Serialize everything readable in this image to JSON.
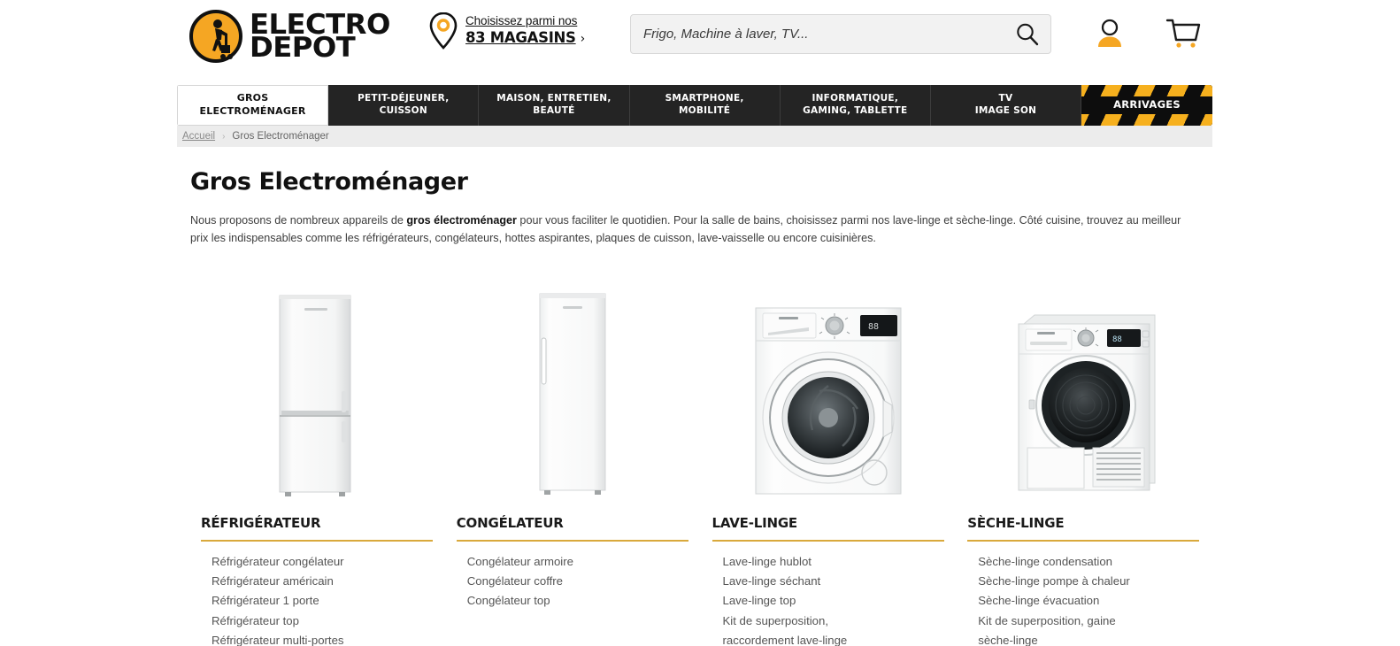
{
  "header": {
    "logo": {
      "line1": "ELECTRO",
      "line2": "DEPOT",
      "icon": "worker-with-trolley-icon"
    },
    "stores": {
      "top_label": "Choisissez parmi nos",
      "count_label": "83 MAGASINS",
      "chevron": "›",
      "pin_icon": "map-pin-icon"
    },
    "search": {
      "placeholder": "Frigo, Machine à laver, TV...",
      "value": "",
      "icon": "search-icon"
    },
    "account_icon": "user-account-icon",
    "cart_icon": "shopping-cart-icon"
  },
  "nav": {
    "items": [
      {
        "label": "GROS\nELECTROMÉNAGER",
        "line1": "GROS",
        "line2": "ELECTROMÉNAGER",
        "active": true
      },
      {
        "line1": "PETIT-DÉJEUNER,",
        "line2": "CUISSON",
        "active": false
      },
      {
        "line1": "MAISON, ENTRETIEN,",
        "line2": "BEAUTÉ",
        "active": false
      },
      {
        "line1": "SMARTPHONE,",
        "line2": "MOBILITÉ",
        "active": false
      },
      {
        "line1": "INFORMATIQUE,",
        "line2": "GAMING, TABLETTE",
        "active": false
      },
      {
        "line1": "TV",
        "line2": "IMAGE SON",
        "active": false
      }
    ],
    "arrivages_label": "ARRIVAGES"
  },
  "breadcrumb": {
    "home": "Accueil",
    "separator": "›",
    "current": "Gros Electroménager"
  },
  "main": {
    "title": "Gros Electroménager",
    "description_part1": "Nous proposons de nombreux appareils de ",
    "description_bold": "gros électroménager",
    "description_part2": " pour vous faciliter le quotidien. Pour la salle de bains, choisissez parmi nos lave-linge et sèche-linge. Côté cuisine, trouvez au meilleur prix les indispensables comme les réfrigérateurs, congélateurs, hottes aspirantes, plaques de cuisson, lave-vaisselle ou encore cuisinières."
  },
  "categories": [
    {
      "heading": "RÉFRIGÉRATEUR",
      "image_name": "fridge-freezer-image",
      "links": [
        "Réfrigérateur congélateur",
        "Réfrigérateur américain",
        "Réfrigérateur 1 porte",
        "Réfrigérateur top",
        "Réfrigérateur multi-portes"
      ]
    },
    {
      "heading": "CONGÉLATEUR",
      "image_name": "upright-freezer-image",
      "links": [
        "Congélateur armoire",
        "Congélateur coffre",
        "Congélateur top"
      ]
    },
    {
      "heading": "LAVE-LINGE",
      "image_name": "washing-machine-image",
      "links": [
        "Lave-linge hublot",
        "Lave-linge séchant",
        "Lave-linge top",
        "Kit de superposition,",
        "raccordement lave-linge"
      ]
    },
    {
      "heading": "SÈCHE-LINGE",
      "image_name": "tumble-dryer-image",
      "links": [
        "Sèche-linge condensation",
        "Sèche-linge pompe à chaleur",
        "Sèche-linge évacuation",
        "Kit de superposition, gaine",
        "sèche-linge"
      ]
    }
  ],
  "colors": {
    "brand_yellow": "#f5a623",
    "hazard_yellow": "#f6b01e",
    "underline_gold": "#d9a93c",
    "nav_dark": "#242424",
    "breadcrumb_bg": "#ececec"
  }
}
